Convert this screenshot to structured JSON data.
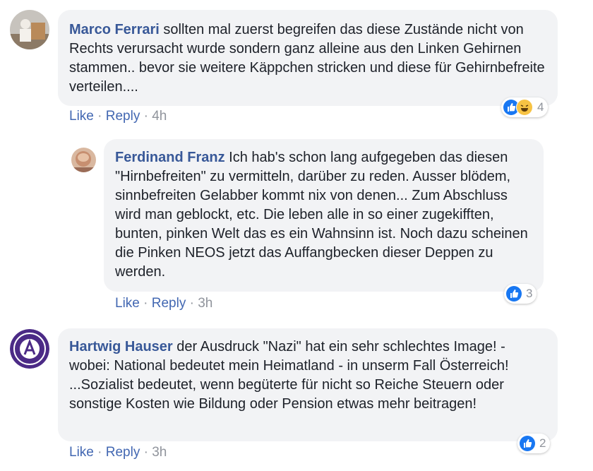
{
  "comments": [
    {
      "author": "Marco Ferrari",
      "text": "sollten mal zuerst begreifen das diese Zustände nicht von Rechts verursacht wurde sondern ganz alleine aus den Linken Gehirnen stammen.. bevor sie weitere Käppchen stricken und diese für Gehirnbefreite verteilen....",
      "like": "Like",
      "reply": "Reply",
      "time": "4h",
      "reaction_count": "4",
      "reactions": [
        "like-icon",
        "haha-icon"
      ]
    },
    {
      "author": "Ferdinand Franz",
      "text": "Ich hab's schon lang aufgegeben das diesen \"Hirnbefreiten\" zu vermitteln, darüber zu reden. Ausser blödem, sinnbefreiten Gelabber kommt nix von denen... Zum Abschluss wird man geblockt, etc. Die leben alle in so einer zugekifften, bunten, pinken Welt das es ein Wahnsinn ist. Noch dazu scheinen die Pinken NEOS jetzt das Auffangbecken dieser Deppen zu werden.",
      "like": "Like",
      "reply": "Reply",
      "time": "3h",
      "reaction_count": "3",
      "reactions": [
        "like-icon"
      ]
    },
    {
      "author": "Hartwig Hauser",
      "text": "der Ausdruck \"Nazi\" hat ein sehr schlechtes Image! - wobei: National bedeutet mein Heimatland - in unserm Fall Österreich! ...Sozialist bedeutet, wenn begüterte für nicht so Reiche Steuern oder sonstige Kosten wie Bildung oder Pension etwas mehr beitragen!",
      "like": "Like",
      "reply": "Reply",
      "time": "3h",
      "reaction_count": "2",
      "reactions": [
        "like-icon"
      ]
    }
  ],
  "separator": "·",
  "colors": {
    "author": "#385898",
    "link": "#4267b2",
    "meta": "#90949c",
    "bubble": "#f2f3f5",
    "like_blue": "#1877f2",
    "haha_yellow": "#f7c344"
  }
}
